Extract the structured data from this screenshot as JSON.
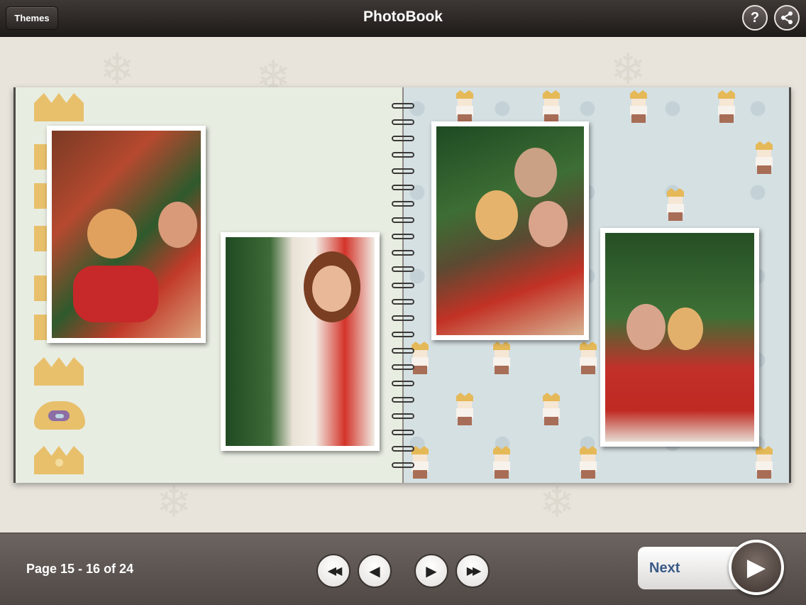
{
  "header": {
    "themes_label": "Themes",
    "title": "PhotoBook",
    "help_glyph": "?",
    "share_glyph": "⤬",
    "help_icon": "help-icon",
    "share_icon": "share-icon"
  },
  "footer": {
    "page_indicator": "Page 15 - 16 of 24",
    "first_glyph": "◀◀",
    "prev_glyph": "◀",
    "next_glyph": "▶",
    "last_glyph": "▶▶",
    "next_label": "Next",
    "next_play_glyph": "▶"
  }
}
